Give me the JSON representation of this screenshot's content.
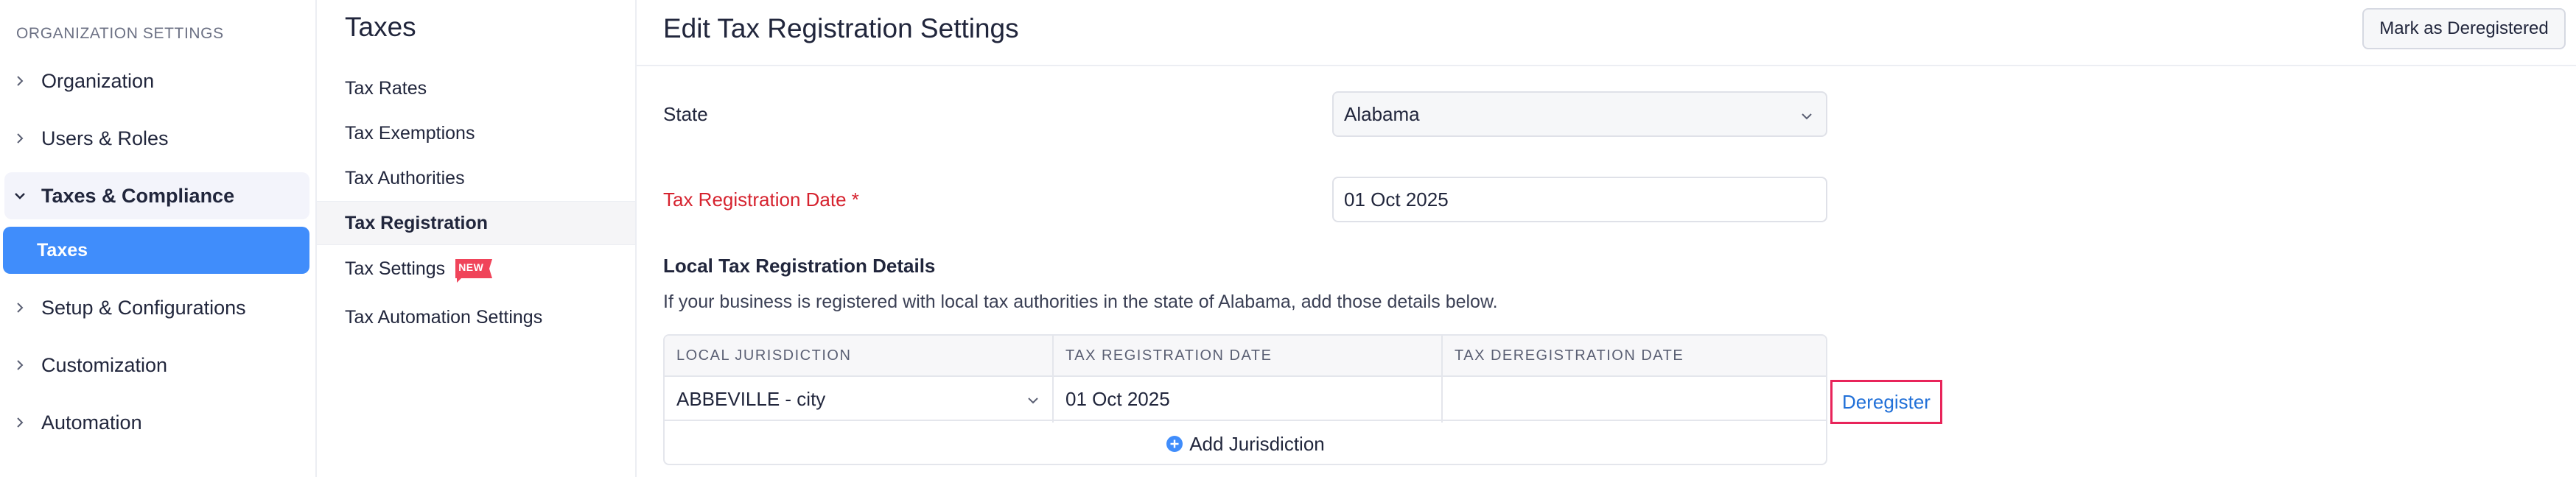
{
  "sidebar": {
    "heading": "ORGANIZATION SETTINGS",
    "items": [
      {
        "label": "Organization"
      },
      {
        "label": "Users & Roles"
      },
      {
        "label": "Taxes & Compliance"
      },
      {
        "label": "Setup & Configurations"
      },
      {
        "label": "Customization"
      },
      {
        "label": "Automation"
      }
    ],
    "subitems": [
      {
        "label": "Taxes",
        "selected": true
      }
    ],
    "expanded": "Taxes & Compliance"
  },
  "midpanel": {
    "title": "Taxes",
    "items": [
      {
        "label": "Tax Rates"
      },
      {
        "label": "Tax Exemptions"
      },
      {
        "label": "Tax Authorities"
      },
      {
        "label": "Tax Registration",
        "active": true
      },
      {
        "label": "Tax Settings",
        "badge": "NEW"
      },
      {
        "label": "Tax Automation Settings"
      }
    ]
  },
  "main": {
    "title": "Edit Tax Registration Settings",
    "mark_deregistered_label": "Mark as Deregistered",
    "form": {
      "state_label": "State",
      "state_value": "Alabama",
      "date_label": "Tax Registration Date *",
      "date_value": "01 Oct 2025"
    },
    "local": {
      "title": "Local Tax Registration Details",
      "description": "If your business is registered with local tax authorities in the state of Alabama, add those details below.",
      "columns": [
        "LOCAL JURISDICTION",
        "TAX REGISTRATION DATE",
        "TAX DEREGISTRATION DATE"
      ],
      "rows": [
        {
          "jurisdiction": "ABBEVILLE - city",
          "registration_date": "01 Oct 2025",
          "deregistration_date": ""
        }
      ],
      "add_label": "Add Jurisdiction",
      "deregister_label": "Deregister"
    }
  },
  "colors": {
    "accent": "#408dfb",
    "required": "#d6232f",
    "link": "#2170d8",
    "highlight_border": "#e8245a",
    "badge": "#f0445a"
  },
  "icons": {
    "collapsed": "chevron-right-icon",
    "expanded": "chevron-down-icon",
    "select": "chevron-down-icon",
    "add": "plus-circle-icon"
  }
}
